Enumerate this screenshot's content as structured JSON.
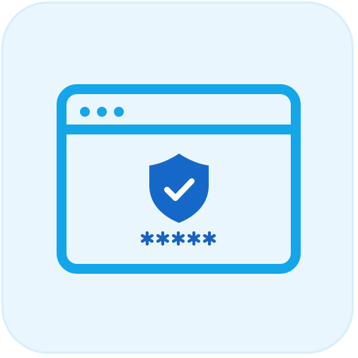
{
  "icon": {
    "name": "secure-password-browser-icon",
    "colors": {
      "tile_background": "#eaf6fe",
      "tile_border": "#d8eefc",
      "window_stroke": "#13a6e8",
      "shield_fill": "#1568c8",
      "checkmark": "#ffffff",
      "password_mask": "#1a63c0"
    },
    "window": {
      "control_dots": 3
    },
    "password_mask": {
      "count": 5,
      "glyph": "asterisk"
    }
  }
}
